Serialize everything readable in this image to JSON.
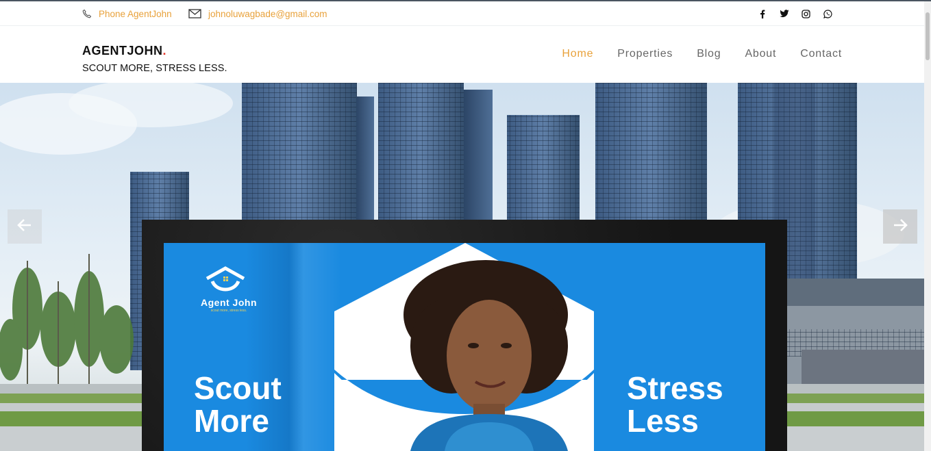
{
  "topbar": {
    "phone_label": "Phone AgentJohn",
    "email_label": "johnoluwagbade@gmail.com",
    "socials": [
      "facebook-icon",
      "twitter-icon",
      "instagram-icon",
      "whatsapp-icon"
    ]
  },
  "header": {
    "brand_name": "AGENTJOHN",
    "brand_dot": ".",
    "tagline": "SCOUT MORE, STRESS LESS.",
    "nav": [
      {
        "label": "Home",
        "active": true
      },
      {
        "label": "Properties",
        "active": false
      },
      {
        "label": "Blog",
        "active": false
      },
      {
        "label": "About",
        "active": false
      },
      {
        "label": "Contact",
        "active": false
      }
    ]
  },
  "hero": {
    "billboard": {
      "logo_name": "Agent John",
      "logo_tagline": "scout more, stress less.",
      "left_line1": "Scout",
      "left_line2": "More",
      "right_line1": "Stress",
      "right_line2": "Less"
    }
  },
  "colors": {
    "accent": "#e8a13a",
    "brand_dot": "#e63b2e",
    "billboard_blue": "#1a8ae0",
    "text_dark": "#111111",
    "nav_text": "#666666"
  }
}
